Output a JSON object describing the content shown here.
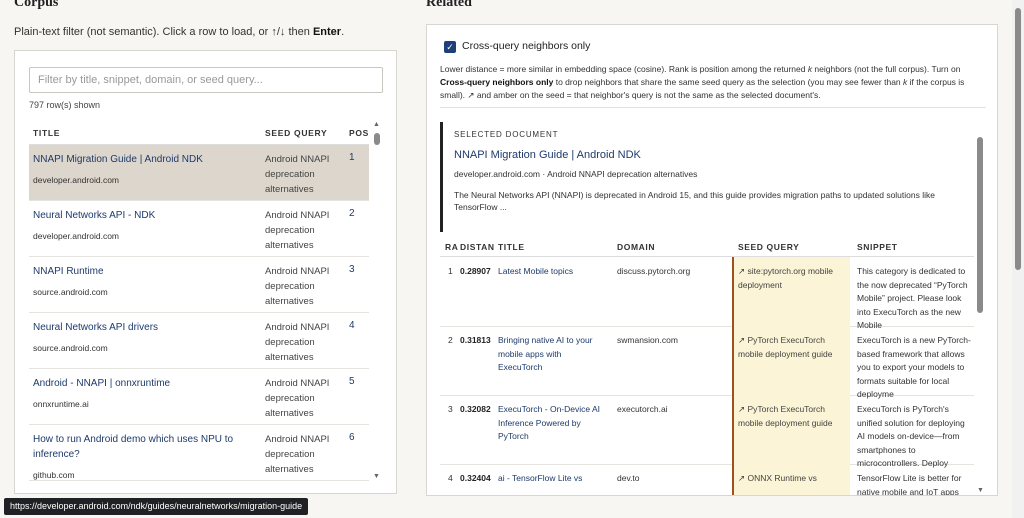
{
  "corpus": {
    "title": "Corpus",
    "hint_prefix": "Plain-text filter (not semantic). Click a row to load, or ↑/↓ then ",
    "hint_key": "Enter",
    "hint_suffix": ".",
    "filter_placeholder": "Filter by title, snippet, domain, or seed query...",
    "filter_value": "",
    "row_count": "797 row(s) shown",
    "columns": {
      "title": "TITLE",
      "seed": "SEED QUERY",
      "pos": "POS"
    },
    "rows": [
      {
        "title": "NNAPI Migration Guide | Android NDK",
        "domain": "developer.android.com",
        "seed": "Android NNAPI deprecation alternatives",
        "pos": "1",
        "selected": true
      },
      {
        "title": "Neural Networks API - NDK",
        "domain": "developer.android.com",
        "seed": "Android NNAPI deprecation alternatives",
        "pos": "2",
        "selected": false
      },
      {
        "title": "NNAPI Runtime",
        "domain": "source.android.com",
        "seed": "Android NNAPI deprecation alternatives",
        "pos": "3",
        "selected": false
      },
      {
        "title": "Neural Networks API drivers",
        "domain": "source.android.com",
        "seed": "Android NNAPI deprecation alternatives",
        "pos": "4",
        "selected": false
      },
      {
        "title": "Android - NNAPI | onnxruntime",
        "domain": "onnxruntime.ai",
        "seed": "Android NNAPI deprecation alternatives",
        "pos": "5",
        "selected": false
      },
      {
        "title": "How to run Android demo which uses NPU to inference?",
        "domain": "github.com",
        "seed": "Android NNAPI deprecation alternatives",
        "pos": "6",
        "selected": false
      }
    ]
  },
  "related": {
    "title": "Related",
    "cross_query_label": "Cross-query neighbors only",
    "cross_query_checked": true,
    "desc_1": "Lower distance = more similar in embedding space (cosine). Rank is position among the returned ",
    "desc_k1": "k",
    "desc_2": " neighbors (not the full corpus). Turn on ",
    "desc_bold": "Cross-query neighbors only",
    "desc_3": " to drop neighbors that share the same seed query as the selection (you may see fewer than ",
    "desc_k2": "k",
    "desc_4": " if the corpus is small). ↗ and amber on the seed = that neighbor's query is not the same as the selected document's.",
    "selected_doc": {
      "label": "SELECTED DOCUMENT",
      "title": "NNAPI Migration Guide | Android NDK",
      "subtitle": "developer.android.com · Android NNAPI deprecation alternatives",
      "body": "The Neural Networks API (NNAPI) is deprecated in Android 15, and this guide provides migration paths to updated solutions like TensorFlow ..."
    },
    "columns": {
      "rank": "RANK",
      "distance": "DISTANCE",
      "title": "TITLE",
      "domain": "DOMAIN",
      "seed": "SEED QUERY",
      "snippet": "SNIPPET"
    },
    "rows": [
      {
        "rank": "1",
        "distance": "0.28907",
        "title": "Latest Mobile topics",
        "domain": "discuss.pytorch.org",
        "seed": "↗ site:pytorch.org mobile deployment",
        "snippet": "This category is dedicated to the now deprecated “PyTorch Mobile” project. Please look into ExecuTorch as the new Mobile"
      },
      {
        "rank": "2",
        "distance": "0.31813",
        "title": "Bringing native AI to your mobile apps with ExecuTorch",
        "domain": "swmansion.com",
        "seed": "↗ PyTorch ExecuTorch mobile deployment guide",
        "snippet": "ExecuTorch is a new PyTorch-based framework that allows you to export your models to formats suitable for local deployme"
      },
      {
        "rank": "3",
        "distance": "0.32082",
        "title": "ExecuTorch - On-Device AI Inference Powered by PyTorch",
        "domain": "executorch.ai",
        "seed": "↗ PyTorch ExecuTorch mobile deployment guide",
        "snippet": "ExecuTorch is PyTorch's unified solution for deploying AI models on-device—from smartphones to microcontrollers. Deploy"
      },
      {
        "rank": "4",
        "distance": "0.32404",
        "title": "ai - TensorFlow Lite vs",
        "domain": "dev.to",
        "seed": "↗ ONNX Runtime vs",
        "snippet": "TensorFlow Lite is better for native mobile and IoT apps"
      }
    ]
  },
  "status_url": "https://developer.android.com/ndk/guides/neuralnetworks/migration-guide",
  "icons": {
    "check": "checkmark-icon",
    "scroll_up": "scroll-up-icon",
    "scroll_down": "scroll-down-icon"
  },
  "colors": {
    "link": "#1e3a6b",
    "selected_row": "#dcd6cc",
    "amber": "#fbf4d6",
    "amber_border": "#a0521c",
    "checkbox": "#1f3f78"
  }
}
